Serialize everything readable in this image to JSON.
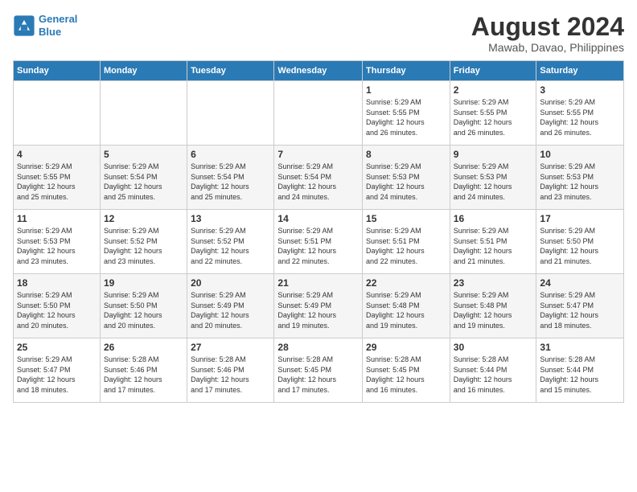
{
  "logo": {
    "line1": "General",
    "line2": "Blue"
  },
  "title": "August 2024",
  "location": "Mawab, Davao, Philippines",
  "days_of_week": [
    "Sunday",
    "Monday",
    "Tuesday",
    "Wednesday",
    "Thursday",
    "Friday",
    "Saturday"
  ],
  "weeks": [
    [
      {
        "day": "",
        "info": ""
      },
      {
        "day": "",
        "info": ""
      },
      {
        "day": "",
        "info": ""
      },
      {
        "day": "",
        "info": ""
      },
      {
        "day": "1",
        "info": "Sunrise: 5:29 AM\nSunset: 5:55 PM\nDaylight: 12 hours\nand 26 minutes."
      },
      {
        "day": "2",
        "info": "Sunrise: 5:29 AM\nSunset: 5:55 PM\nDaylight: 12 hours\nand 26 minutes."
      },
      {
        "day": "3",
        "info": "Sunrise: 5:29 AM\nSunset: 5:55 PM\nDaylight: 12 hours\nand 26 minutes."
      }
    ],
    [
      {
        "day": "4",
        "info": "Sunrise: 5:29 AM\nSunset: 5:55 PM\nDaylight: 12 hours\nand 25 minutes."
      },
      {
        "day": "5",
        "info": "Sunrise: 5:29 AM\nSunset: 5:54 PM\nDaylight: 12 hours\nand 25 minutes."
      },
      {
        "day": "6",
        "info": "Sunrise: 5:29 AM\nSunset: 5:54 PM\nDaylight: 12 hours\nand 25 minutes."
      },
      {
        "day": "7",
        "info": "Sunrise: 5:29 AM\nSunset: 5:54 PM\nDaylight: 12 hours\nand 24 minutes."
      },
      {
        "day": "8",
        "info": "Sunrise: 5:29 AM\nSunset: 5:53 PM\nDaylight: 12 hours\nand 24 minutes."
      },
      {
        "day": "9",
        "info": "Sunrise: 5:29 AM\nSunset: 5:53 PM\nDaylight: 12 hours\nand 24 minutes."
      },
      {
        "day": "10",
        "info": "Sunrise: 5:29 AM\nSunset: 5:53 PM\nDaylight: 12 hours\nand 23 minutes."
      }
    ],
    [
      {
        "day": "11",
        "info": "Sunrise: 5:29 AM\nSunset: 5:53 PM\nDaylight: 12 hours\nand 23 minutes."
      },
      {
        "day": "12",
        "info": "Sunrise: 5:29 AM\nSunset: 5:52 PM\nDaylight: 12 hours\nand 23 minutes."
      },
      {
        "day": "13",
        "info": "Sunrise: 5:29 AM\nSunset: 5:52 PM\nDaylight: 12 hours\nand 22 minutes."
      },
      {
        "day": "14",
        "info": "Sunrise: 5:29 AM\nSunset: 5:51 PM\nDaylight: 12 hours\nand 22 minutes."
      },
      {
        "day": "15",
        "info": "Sunrise: 5:29 AM\nSunset: 5:51 PM\nDaylight: 12 hours\nand 22 minutes."
      },
      {
        "day": "16",
        "info": "Sunrise: 5:29 AM\nSunset: 5:51 PM\nDaylight: 12 hours\nand 21 minutes."
      },
      {
        "day": "17",
        "info": "Sunrise: 5:29 AM\nSunset: 5:50 PM\nDaylight: 12 hours\nand 21 minutes."
      }
    ],
    [
      {
        "day": "18",
        "info": "Sunrise: 5:29 AM\nSunset: 5:50 PM\nDaylight: 12 hours\nand 20 minutes."
      },
      {
        "day": "19",
        "info": "Sunrise: 5:29 AM\nSunset: 5:50 PM\nDaylight: 12 hours\nand 20 minutes."
      },
      {
        "day": "20",
        "info": "Sunrise: 5:29 AM\nSunset: 5:49 PM\nDaylight: 12 hours\nand 20 minutes."
      },
      {
        "day": "21",
        "info": "Sunrise: 5:29 AM\nSunset: 5:49 PM\nDaylight: 12 hours\nand 19 minutes."
      },
      {
        "day": "22",
        "info": "Sunrise: 5:29 AM\nSunset: 5:48 PM\nDaylight: 12 hours\nand 19 minutes."
      },
      {
        "day": "23",
        "info": "Sunrise: 5:29 AM\nSunset: 5:48 PM\nDaylight: 12 hours\nand 19 minutes."
      },
      {
        "day": "24",
        "info": "Sunrise: 5:29 AM\nSunset: 5:47 PM\nDaylight: 12 hours\nand 18 minutes."
      }
    ],
    [
      {
        "day": "25",
        "info": "Sunrise: 5:29 AM\nSunset: 5:47 PM\nDaylight: 12 hours\nand 18 minutes."
      },
      {
        "day": "26",
        "info": "Sunrise: 5:28 AM\nSunset: 5:46 PM\nDaylight: 12 hours\nand 17 minutes."
      },
      {
        "day": "27",
        "info": "Sunrise: 5:28 AM\nSunset: 5:46 PM\nDaylight: 12 hours\nand 17 minutes."
      },
      {
        "day": "28",
        "info": "Sunrise: 5:28 AM\nSunset: 5:45 PM\nDaylight: 12 hours\nand 17 minutes."
      },
      {
        "day": "29",
        "info": "Sunrise: 5:28 AM\nSunset: 5:45 PM\nDaylight: 12 hours\nand 16 minutes."
      },
      {
        "day": "30",
        "info": "Sunrise: 5:28 AM\nSunset: 5:44 PM\nDaylight: 12 hours\nand 16 minutes."
      },
      {
        "day": "31",
        "info": "Sunrise: 5:28 AM\nSunset: 5:44 PM\nDaylight: 12 hours\nand 15 minutes."
      }
    ]
  ]
}
